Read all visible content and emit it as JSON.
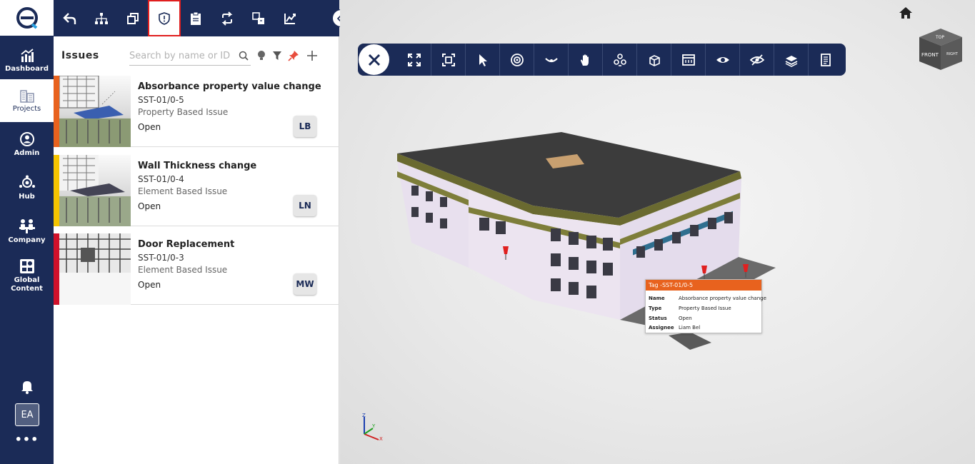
{
  "nav": {
    "items": [
      {
        "label": "Dashboard",
        "icon": "chart-icon"
      },
      {
        "label": "Projects",
        "icon": "building-icon"
      },
      {
        "label": "Admin",
        "icon": "user-circle-icon"
      },
      {
        "label": "Hub",
        "icon": "hub-icon"
      },
      {
        "label": "Company",
        "icon": "company-icon"
      },
      {
        "label": "Global Content",
        "icon": "global-content-icon"
      }
    ],
    "avatar": "EA",
    "more": "•••"
  },
  "panel": {
    "title": "Issues",
    "search_placeholder": "Search by name or ID"
  },
  "issues": [
    {
      "title": "Absorbance property value change",
      "id": "SST-01/0-5",
      "type": "Property Based Issue",
      "status": "Open",
      "assignee": "LB",
      "color": "#e8621e"
    },
    {
      "title": "Wall Thickness change",
      "id": "SST-01/0-4",
      "type": "Element Based Issue",
      "status": "Open",
      "assignee": "LN",
      "color": "#f5c400"
    },
    {
      "title": "Door Replacement",
      "id": "SST-01/0-3",
      "type": "Element Based Issue",
      "status": "Open",
      "assignee": "MW",
      "color": "#d0112b"
    }
  ],
  "viewcube": {
    "top": "TOP",
    "front": "FRONT",
    "right": "RIGHT"
  },
  "tooltip": {
    "header": "Tag -SST-01/0-5",
    "rows": [
      {
        "key": "Name",
        "value": "Absorbance property value change"
      },
      {
        "key": "Type",
        "value": "Property Based Issue"
      },
      {
        "key": "Status",
        "value": "Open"
      },
      {
        "key": "Assignee",
        "value": "Liam Bel"
      }
    ]
  },
  "axis": {
    "x": "X",
    "y": "Y",
    "z": "Z"
  },
  "colors": {
    "navy": "#1b2b57",
    "accent": "#e8621e",
    "selected_border": "#e01e1e"
  }
}
